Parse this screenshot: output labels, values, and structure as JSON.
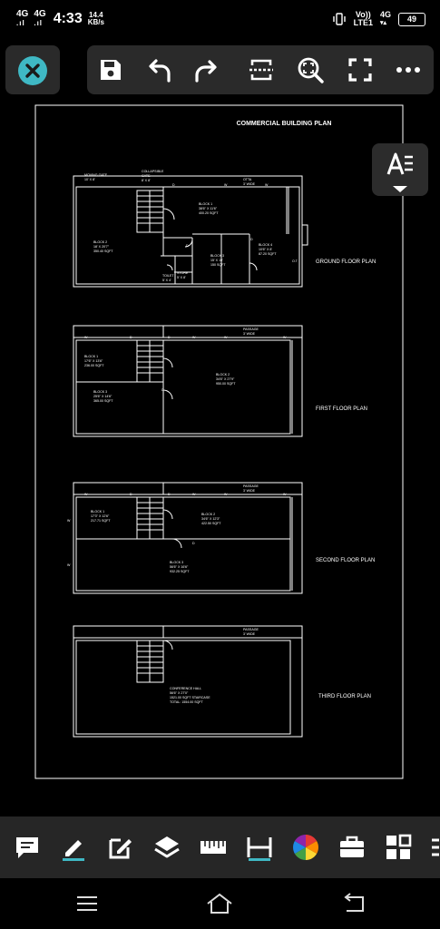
{
  "status": {
    "sim1": "4G",
    "sim2": "4G",
    "time": "4:33",
    "speed_value": "14.4",
    "speed_unit": "KB/s",
    "volte_top": "Vo))",
    "volte_bottom": "LTE1",
    "net2": "4G",
    "battery": "49"
  },
  "toolbar": {
    "icons": [
      "save-icon",
      "undo-icon",
      "redo-icon",
      "compare-icon",
      "zoom-icon",
      "fullscreen-icon",
      "more-icon"
    ]
  },
  "drawing": {
    "title": "COMMERCIAL BUILDING PLAN",
    "ground": {
      "label": "GROUND FLOOR PLAN",
      "moving_gate": [
        "MOVING GATE",
        "10' X 8'"
      ],
      "collapsible": [
        "COLLAPSIBLE",
        "GATE",
        "8' X 8'"
      ],
      "otta": [
        "OTTA",
        "3' WIDE"
      ],
      "block1": [
        "BLOCK 1",
        "38'6\" X 11'6\"",
        "400.20 SQFT"
      ],
      "block2": [
        "BLOCK 2",
        "18' X 20'7\"",
        "350.40 SQFT"
      ],
      "block3": [
        "BLOCK 3",
        "15' X 10'",
        "150 SQFT"
      ],
      "block4": [
        "BLOCK 4",
        "10'6\" X 8'",
        "87.20 SQFT"
      ],
      "toilet": [
        "TOILET",
        "5' X 4'"
      ],
      "store": [
        "STORE",
        "5' X 8'"
      ],
      "ot": "O.T"
    },
    "first": {
      "label": "FIRST FLOOR PLAN",
      "passage": [
        "PASSAGE",
        "3' WIDE"
      ],
      "block1": [
        "BLOCK 1",
        "17'6\" X 13'6\"",
        "236.00 SQFT"
      ],
      "block2": [
        "BLOCK 2",
        "34'6\" X 27'9\"",
        "950.00 SQFT"
      ],
      "block3": [
        "BLOCK 3",
        "25'6\" X 14'6\"",
        "365.00 SQFT"
      ]
    },
    "second": {
      "label": "SECOND FLOOR PLAN",
      "passage": [
        "PASSAGE",
        "3' WIDE"
      ],
      "block1": [
        "BLOCK 1",
        "17'3\" X 12'6\"",
        "217.71 SQFT"
      ],
      "block2": [
        "BLOCK 2",
        "34'6\" X 12'3\"",
        "422.50 SQFT"
      ],
      "block3": [
        "BLOCK 3",
        "56'6\" X 16'6\"",
        "932.25 SQFT"
      ]
    },
    "third": {
      "label": "THIRD FLOOR PLAN",
      "passage": [
        "PASSAGE",
        "3' WIDE"
      ],
      "hall": [
        "CONFERENCE HALL",
        "56'6\" X 27'0\"",
        "1521.00 SQFT  STAIRCASE",
        "TOTAL: 1554.00 SQFT"
      ]
    }
  },
  "bottombar": {
    "icons": [
      "comment-icon",
      "pencil-icon",
      "edit-square-icon",
      "layers-icon",
      "ruler-icon",
      "dimension-icon",
      "color-wheel-icon",
      "toolbox-icon",
      "blocks-icon",
      "more-tools-icon"
    ]
  }
}
